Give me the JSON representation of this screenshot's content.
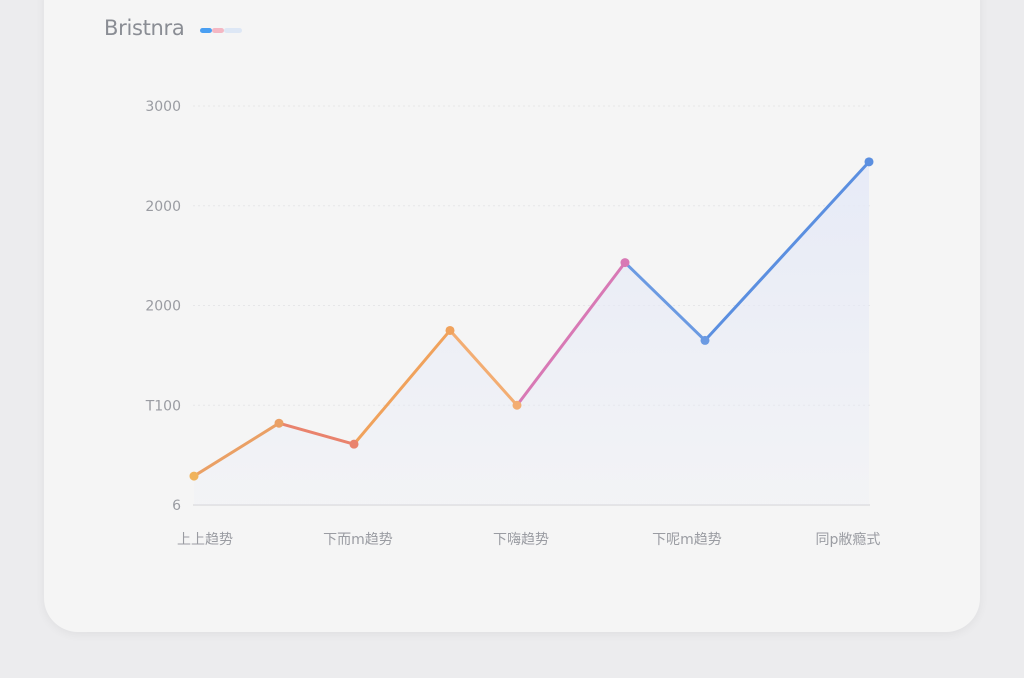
{
  "chart_data": {
    "type": "line",
    "title": "Bristnra",
    "y_tick_labels": [
      "6",
      "T100",
      "2000",
      "2000",
      "3000"
    ],
    "x_tick_labels": [
      "上上趋势",
      "下而m趋势",
      "下嗨趋势",
      "下呢m趋势",
      "同p敝瘾式"
    ],
    "ylim": [
      0,
      4
    ],
    "series": [
      {
        "values": [
          0.29,
          0.82,
          0.61,
          1.75,
          1.0,
          2.43,
          1.65,
          3.44
        ],
        "colors": [
          "#f0b35b",
          "#eaa065",
          "#e9836d",
          "#f0a25c",
          "#f3ad72",
          "#d879b5",
          "#6b9ae2",
          "#5b8fe0"
        ]
      }
    ],
    "area_fill": "#e6eaf7",
    "grid": true,
    "legend": {
      "position": "top-left",
      "swatch_colors": [
        "#4a9ff2",
        "#f4b7c3",
        "#dde7f5"
      ]
    }
  }
}
